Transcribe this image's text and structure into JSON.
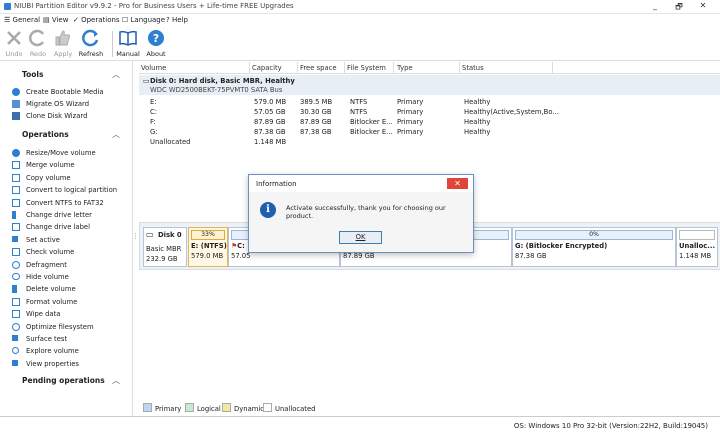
{
  "window": {
    "title": "NIUBI Partition Editor v9.9.2 - Pro for Business Users + Life-time FREE Upgrades",
    "minimize": "_",
    "restore": "🗗",
    "close": "✕"
  },
  "menu": [
    {
      "label": "General"
    },
    {
      "label": "View"
    },
    {
      "label": "Operations"
    },
    {
      "label": "Language"
    },
    {
      "label": "Help"
    }
  ],
  "toolbar": {
    "undo": "Undo",
    "redo": "Redo",
    "apply": "Apply",
    "refresh": "Refresh",
    "manual": "Manual",
    "about": "About"
  },
  "sidebar": {
    "tools_title": "Tools",
    "tools": [
      "Create Bootable Media",
      "Migrate OS Wizard",
      "Clone Disk Wizard"
    ],
    "operations_title": "Operations",
    "operations": [
      "Resize/Move volume",
      "Merge volume",
      "Copy volume",
      "Convert to logical partition",
      "Convert NTFS to FAT32",
      "Change drive letter",
      "Change drive label",
      "Set active",
      "Check volume",
      "Defragment",
      "Hide volume",
      "Delete volume",
      "Format volume",
      "Wipe data",
      "Optimize filesystem",
      "Surface test",
      "Explore volume",
      "View properties"
    ],
    "pending_title": "Pending operations"
  },
  "table": {
    "headers": [
      "Volume",
      "Capacity",
      "Free space",
      "File System",
      "Type",
      "Status"
    ],
    "disk_title": "Disk 0: Hard disk, Basic MBR, Healthy",
    "disk_sub": "WDC WD2500BEKT-75PVMT0 SATA Bus",
    "rows": [
      [
        "E:",
        "579.0 MB",
        "389.5 MB",
        "NTFS",
        "Primary",
        "Healthy"
      ],
      [
        "C:",
        "57.05 GB",
        "30.30 GB",
        "NTFS",
        "Primary",
        "Healthy(Active,System,Bo..."
      ],
      [
        "F:",
        "87.89 GB",
        "87.89 GB",
        "Bitlocker E...",
        "Primary",
        "Healthy"
      ],
      [
        "G:",
        "87.38 GB",
        "87.38 GB",
        "Bitlocker E...",
        "Primary",
        "Healthy"
      ],
      [
        "Unallocated",
        "1.148 MB",
        "",
        "",
        "",
        ""
      ]
    ]
  },
  "diskmap": {
    "disk_label": "Disk 0",
    "disk_type": "Basic MBR",
    "disk_size": "232.9 GB",
    "e_pct": "33%",
    "e_name": "E: (NTFS)",
    "e_size": "579.0 MB",
    "c_name": "C:",
    "c_size": "57.05",
    "f_size": "87.89 GB",
    "g_pct": "0%",
    "g_name": "G: (Bitlocker Encrypted)",
    "g_size": "87.38 GB",
    "u_name": "Unalloc...",
    "u_size": "1.148 MB"
  },
  "legend": [
    "Primary",
    "Logical",
    "Dynamic",
    "Unallocated"
  ],
  "status": "OS: Windows 10 Pro 32-bit (Version:22H2, Build:19045)",
  "dialog": {
    "title": "Information",
    "message": "Activate successfully, thank you for choosing our product.",
    "ok": "OK",
    "close": "✕",
    "info_glyph": "i"
  }
}
